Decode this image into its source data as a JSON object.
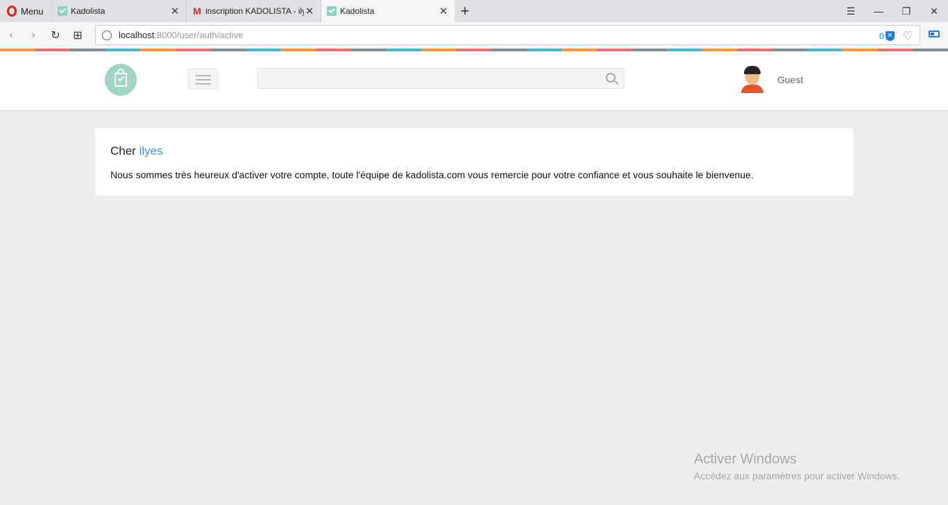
{
  "browser": {
    "menu_label": "Menu",
    "tabs": [
      {
        "title": "Kadolista",
        "favicon": "kadolista-icon",
        "active": false
      },
      {
        "title": "inscription KADOLISTA - ily",
        "favicon": "gmail-icon",
        "active": false
      },
      {
        "title": "Kadolista",
        "favicon": "kadolista-icon",
        "active": true
      }
    ],
    "url": {
      "host": "localhost",
      "path": ":8000/user/auth/active"
    },
    "adblock_count": "0",
    "stripe_colors": [
      "#f79a3e",
      "#e8716a",
      "#7d8b92",
      "#4fb5cf"
    ]
  },
  "header": {
    "logo": "kadolista-logo",
    "search": {
      "value": "",
      "placeholder": ""
    },
    "user_label": "Guest"
  },
  "main": {
    "greeting_prefix": "Cher",
    "user_name": "ilyes",
    "message": "Nous sommes très heureux d'activer votre compte, toute l'équipe de kadolista.com vous remercie pour votre confiance et vous souhaite le bienvenue."
  },
  "watermark": {
    "title": "Activer Windows",
    "subtitle": "Accédez aux paramètres pour activer Windows."
  }
}
